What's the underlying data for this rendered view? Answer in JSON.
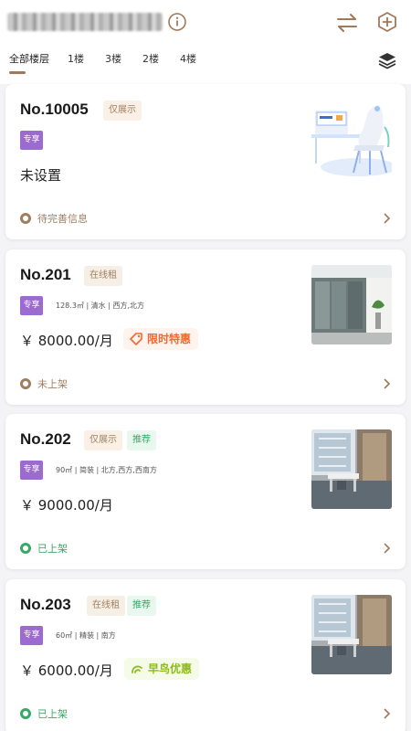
{
  "header": {
    "info_icon": "info-circle-icon",
    "swap_icon": "swap-arrows-icon",
    "add_icon": "plus-circle-icon",
    "layers_icon": "layers-icon"
  },
  "tabs": [
    {
      "label": "全部楼层",
      "active": true
    },
    {
      "label": "1楼"
    },
    {
      "label": "3楼"
    },
    {
      "label": "2楼"
    },
    {
      "label": "4楼"
    }
  ],
  "colors": {
    "accent": "#a0785a",
    "exclusive": "#9c6bcf",
    "green": "#3aa866",
    "limited": "#f06a2e",
    "early": "#8cba1a"
  },
  "cards": [
    {
      "no": "No.10005",
      "tags": [
        "仅展示"
      ],
      "exclusive": "专享",
      "specs": "",
      "main_text": "未设置",
      "promo": "",
      "status": "待完善信息",
      "status_color": "gold",
      "thumb": "office-chair-illustration"
    },
    {
      "no": "No.201",
      "tags": [
        "在线租"
      ],
      "exclusive": "专享",
      "specs": "128.3㎡ | 清水 | 西方,北方",
      "main_text": "￥ 8000.00/月",
      "promo": "限时特惠",
      "status": "未上架",
      "status_color": "gold",
      "thumb": "glass-office-photo"
    },
    {
      "no": "No.202",
      "tags": [
        "仅展示",
        "推荐"
      ],
      "exclusive": "专享",
      "specs": "90㎡ | 简装 | 北方,西方,西南方",
      "main_text": "￥ 9000.00/月",
      "promo": "",
      "status": "已上架",
      "status_color": "green",
      "thumb": "furnished-office-photo"
    },
    {
      "no": "No.203",
      "tags": [
        "在线租",
        "推荐"
      ],
      "exclusive": "专享",
      "specs": "60㎡ | 精装 | 南方",
      "main_text": "￥ 6000.00/月",
      "promo": "早鸟优惠",
      "status": "已上架",
      "status_color": "green",
      "thumb": "furnished-office-photo"
    }
  ]
}
